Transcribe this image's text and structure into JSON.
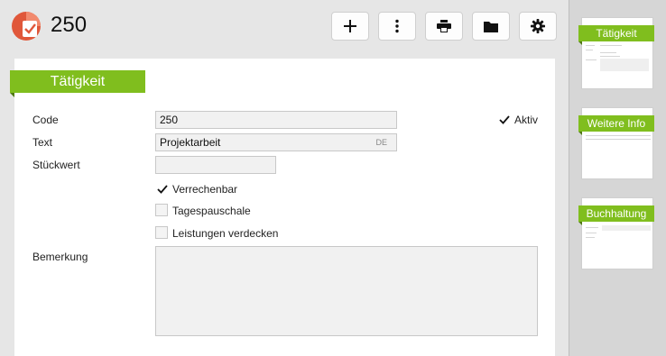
{
  "header": {
    "record_title": "250",
    "buttons": [
      {
        "name": "add",
        "icon": "plus-icon"
      },
      {
        "name": "more",
        "icon": "more-vertical-icon"
      },
      {
        "name": "print",
        "icon": "printer-icon"
      },
      {
        "name": "folder",
        "icon": "folder-icon"
      },
      {
        "name": "settings",
        "icon": "gear-icon"
      }
    ]
  },
  "section": {
    "title": "Tätigkeit"
  },
  "form": {
    "code_label": "Code",
    "code_value": "250",
    "text_label": "Text",
    "text_value": "Projektarbeit",
    "text_lang": "DE",
    "unit_label": "Stückwert",
    "unit_value": "",
    "remark_label": "Bemerkung",
    "remark_value": "",
    "active_label": "Aktiv",
    "active_checked": true,
    "checkboxes": [
      {
        "label": "Verrechenbar",
        "checked": true
      },
      {
        "label": "Tagespauschale",
        "checked": false
      },
      {
        "label": "Leistungen verdecken",
        "checked": false
      }
    ]
  },
  "navigator": {
    "thumbs": [
      {
        "label": "Tätigkeit"
      },
      {
        "label": "Weitere Info"
      },
      {
        "label": "Buchhaltung"
      }
    ]
  },
  "colors": {
    "accent": "#80be1e",
    "logo_red": "#e0573a"
  }
}
